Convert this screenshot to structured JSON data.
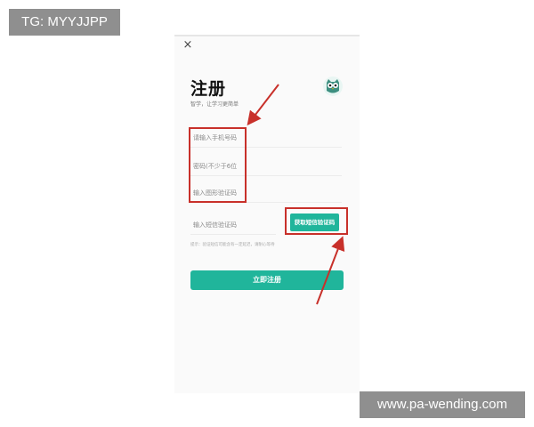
{
  "watermark": {
    "tg_label": "TG: MYYJJPP",
    "site_url": "www.pa-wending.com"
  },
  "register_page": {
    "close_glyph": "×",
    "title": "注册",
    "subtitle": "智学，让学习更简单",
    "logo_icon": "owl-logo-icon",
    "phone_placeholder": "请输入手机号码",
    "password_placeholder": "密码(不少于6位",
    "captcha_placeholder": "输入图形验证码",
    "sms_placeholder": "输入短信验证码",
    "get_code_label": "获取短信验证码",
    "hint": "提示：验证短信可能含有一定延迟，请耐心等待",
    "register_label": "立即注册"
  },
  "colors": {
    "accent": "#20b59b",
    "annotation": "#c8302a"
  }
}
